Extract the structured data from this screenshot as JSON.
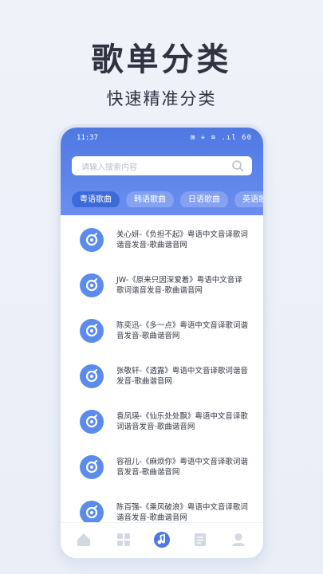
{
  "promo": {
    "title": "歌单分类",
    "subtitle": "快速精准分类"
  },
  "status_bar": {
    "time": "11:37",
    "icons": "⊠ ✈ ≋ .ıl 60"
  },
  "search": {
    "placeholder": "请输入搜索内容",
    "icon": "search-icon"
  },
  "tabs": [
    {
      "label": "粤语歌曲",
      "active": true
    },
    {
      "label": "韩语歌曲",
      "active": false
    },
    {
      "label": "日语歌曲",
      "active": false
    },
    {
      "label": "英语歌曲",
      "active": false
    }
  ],
  "songs": [
    {
      "title": "关心妍-《负担不起》粤语中文音译歌词谐音发音-歌曲谐音网"
    },
    {
      "title": "JW-《原来只因深爱着》粤语中文音译歌词谐音发音-歌曲谐音网"
    },
    {
      "title": "陈奕迅-《多一点》粤语中文音译歌词谐音发音-歌曲谐音网"
    },
    {
      "title": "张敬轩-《透露》粤语中文音译歌词谐音发音-歌曲谐音网"
    },
    {
      "title": "袁凤瑛-《仙乐处处飘》粤语中文音译歌词谐音发音-歌曲谐音网"
    },
    {
      "title": "容祖儿-《麻烦你》粤语中文音译歌词谐音发音-歌曲谐音网"
    },
    {
      "title": "陈百强-《乘风破浪》粤语中文音译歌词谐音发音-歌曲谐音网"
    }
  ],
  "bottom_nav": [
    {
      "icon": "home-icon",
      "active": false
    },
    {
      "icon": "grid-icon",
      "active": false
    },
    {
      "icon": "music-note-icon",
      "active": true
    },
    {
      "icon": "document-icon",
      "active": false
    },
    {
      "icon": "user-icon",
      "active": false
    }
  ],
  "colors": {
    "accent": "#4f78e2",
    "tab_active": "#3d6ad9",
    "avatar": "#5b8cec",
    "nav_inactive": "#d3d8e2"
  }
}
